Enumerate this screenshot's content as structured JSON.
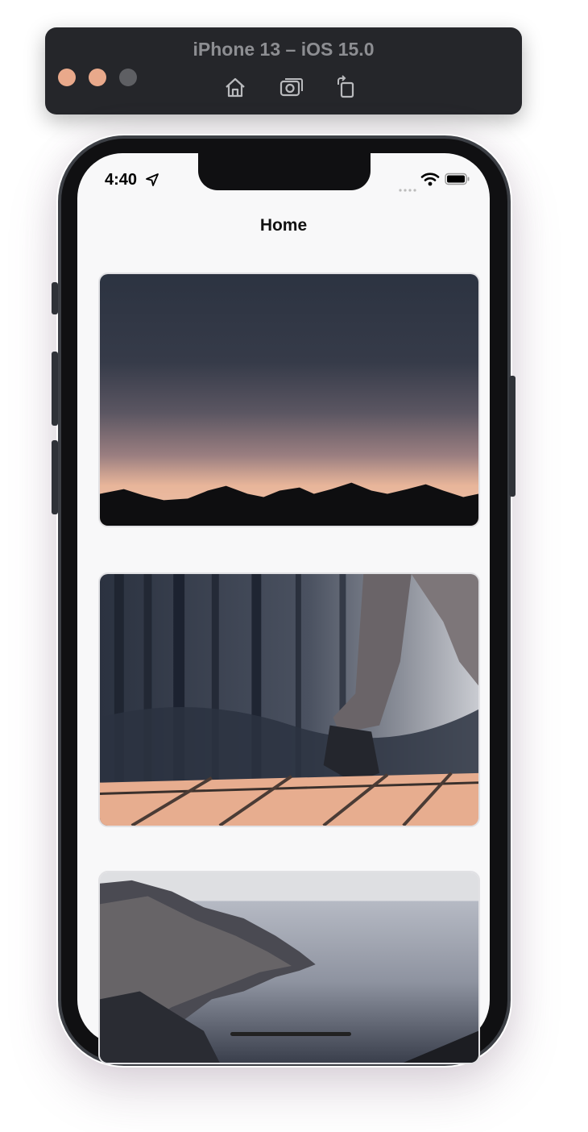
{
  "simulator": {
    "title": "iPhone 13 – iOS 15.0",
    "window_controls": [
      "close",
      "minimize",
      "zoom"
    ],
    "toolbar_icons": [
      "home-icon",
      "screenshot-icon",
      "rotate-icon"
    ],
    "colors": {
      "toolbar_bg": "#25262a",
      "close": "#e9a98b",
      "minimize": "#e9a98b",
      "zoom": "#5e5f63",
      "title": "#8d8e92"
    }
  },
  "status_bar": {
    "time": "4:40",
    "location_icon": "location-arrow-icon",
    "wifi_icon": "wifi-icon",
    "battery_icon": "battery-icon"
  },
  "nav": {
    "title": "Home"
  },
  "feed": {
    "cards": [
      {
        "image": "mountain-sunset-image"
      },
      {
        "image": "hiker-boardwalk-image"
      },
      {
        "image": "coastal-cliff-image"
      }
    ]
  }
}
